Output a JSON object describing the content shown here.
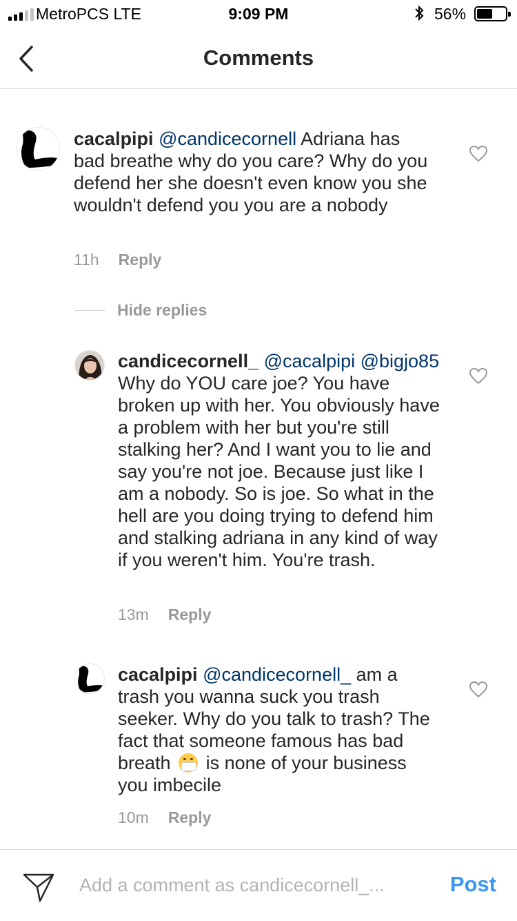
{
  "status_bar": {
    "carrier": "MetroPCS  LTE",
    "time": "9:09 PM",
    "battery_percent": "56%",
    "battery_level": 0.56,
    "signal_bars_filled": 3,
    "signal_bars_total": 5
  },
  "nav": {
    "title": "Comments",
    "back_icon": "chevron-left-icon"
  },
  "comments": [
    {
      "username": "cacalpipi",
      "mention": "@candicecornell",
      "text": " Adriana has bad breathe why do you care? Why do you defend her she doesn't even know you she wouldn't defend you you are a nobody",
      "time": "11h",
      "reply_label": "Reply"
    },
    {
      "username": "candicecornell_",
      "mention": "@cacalpipi @bigjo85",
      "text": " Why do YOU care joe? You have broken up with her. You obviously have a problem with her but you're still stalking her? And I want you to lie and say you're not joe. Because just like I am a nobody. So is joe. So what in the hell are you doing trying to defend him and stalking adriana in any kind of way if you weren't him. You're trash.",
      "time": "13m",
      "reply_label": "Reply"
    },
    {
      "username": "cacalpipi",
      "mention": "@candicecornell_",
      "text_before_emoji": " am a trash you wanna suck you trash seeker. Why do you talk to trash? The fact that someone famous has bad breath",
      "emoji": "face-with-medical-mask",
      "text_after_emoji": " is none of your business you imbecile",
      "time": "10m",
      "reply_label": "Reply"
    }
  ],
  "hide_replies_label": "Hide replies",
  "composer": {
    "placeholder": "Add a comment as candicecornell_...",
    "post_label": "Post"
  },
  "colors": {
    "mention": "#003569",
    "post_button": "#3897f0",
    "meta_gray": "#999999"
  }
}
